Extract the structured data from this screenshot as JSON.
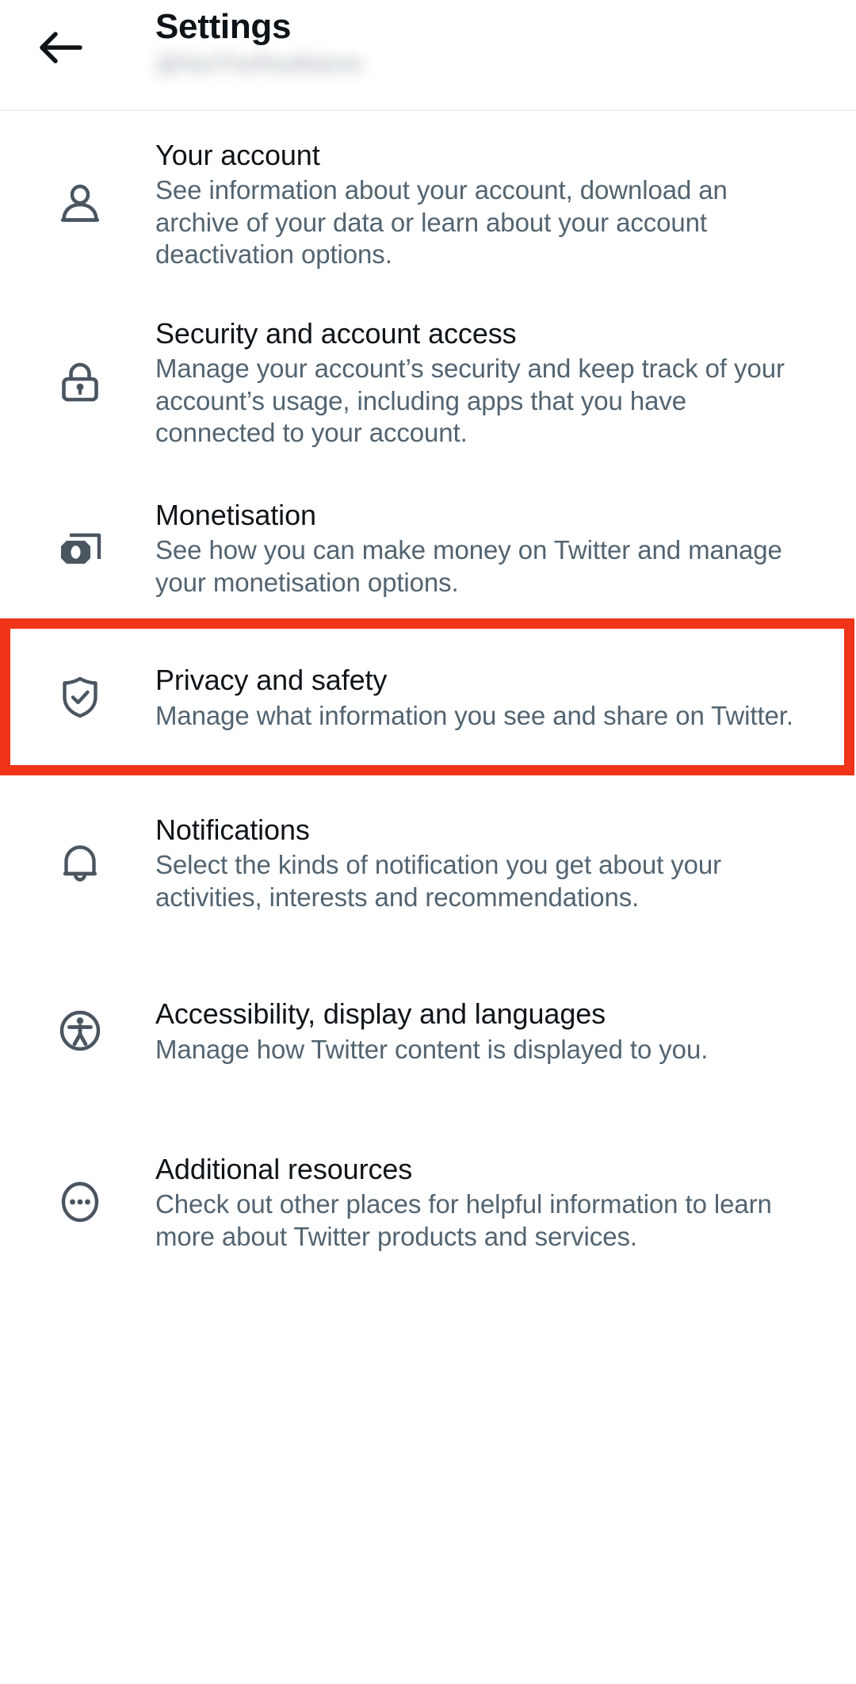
{
  "header": {
    "back_icon": "arrow-left-icon",
    "title": "Settings",
    "account_handle": "@NotTheRealName"
  },
  "colors": {
    "text_primary": "#0f1419",
    "text_secondary": "#536471",
    "icon": "#4a5560",
    "divider": "#eff3f4",
    "highlight": "#f03418",
    "background": "#ffffff"
  },
  "settings": {
    "items": [
      {
        "id": "your-account",
        "icon": "person-icon",
        "title": "Your account",
        "description": "See information about your account, download an archive of your data or learn about your account deactivation options.",
        "highlighted": false
      },
      {
        "id": "security-and-account-access",
        "icon": "lock-icon",
        "title": "Security and account access",
        "description": "Manage your account’s security and keep track of your account’s usage, including apps that you have connected to your account.",
        "highlighted": false
      },
      {
        "id": "monetisation",
        "icon": "banknote-icon",
        "title": "Monetisation",
        "description": "See how you can make money on Twitter and manage your monetisation options.",
        "highlighted": false
      },
      {
        "id": "privacy-and-safety",
        "icon": "shield-check-icon",
        "title": "Privacy and safety",
        "description": "Manage what information you see and share on Twitter.",
        "highlighted": true
      },
      {
        "id": "notifications",
        "icon": "bell-icon",
        "title": "Notifications",
        "description": "Select the kinds of notification you get about your activities, interests and recommendations.",
        "highlighted": false
      },
      {
        "id": "accessibility-display-and-languages",
        "icon": "accessibility-icon",
        "title": "Accessibility, display and languages",
        "description": "Manage how Twitter content is displayed to you.",
        "highlighted": false
      },
      {
        "id": "additional-resources",
        "icon": "ellipsis-circle-icon",
        "title": "Additional resources",
        "description": "Check out other places for helpful information to learn more about Twitter products and services.",
        "highlighted": false
      }
    ]
  }
}
